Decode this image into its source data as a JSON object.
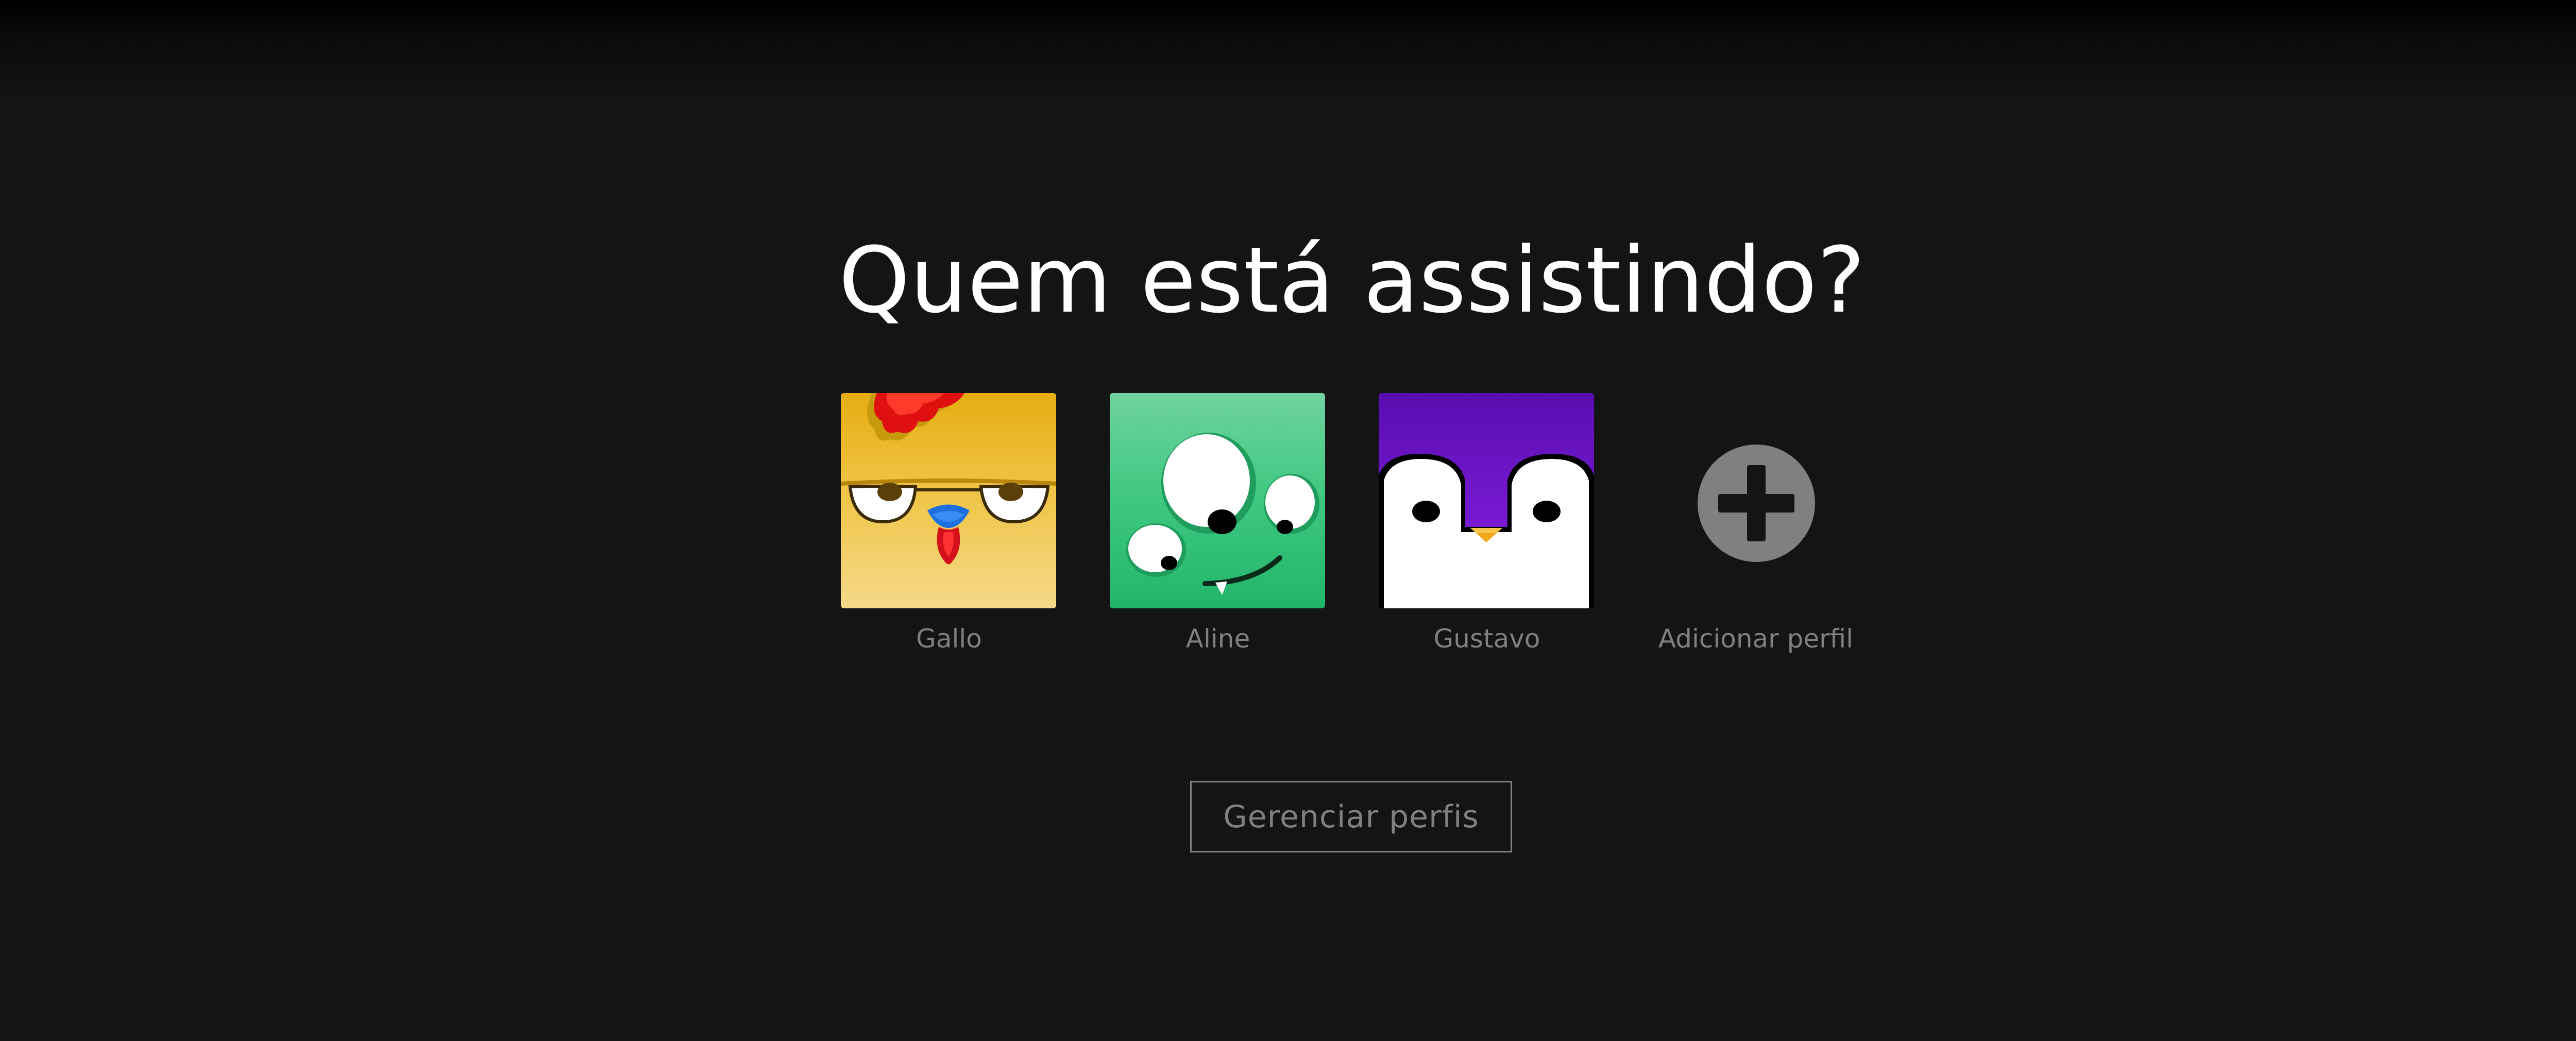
{
  "heading": "Quem está assistindo?",
  "profiles": [
    {
      "name": "Gallo",
      "avatar_icon": "rooster-avatar-icon",
      "color": "#e8b51a"
    },
    {
      "name": "Aline",
      "avatar_icon": "green-monster-avatar-icon",
      "color": "#2ebd73"
    },
    {
      "name": "Gustavo",
      "avatar_icon": "penguin-avatar-icon",
      "color": "#6a0fc4"
    }
  ],
  "add_profile": {
    "label": "Adicionar perfil",
    "icon": "plus-circle-icon",
    "color": "#808080"
  },
  "manage_button": {
    "label": "Gerenciar perfis"
  },
  "theme": {
    "background": "#141414",
    "text": "#ffffff",
    "muted": "#808080"
  }
}
